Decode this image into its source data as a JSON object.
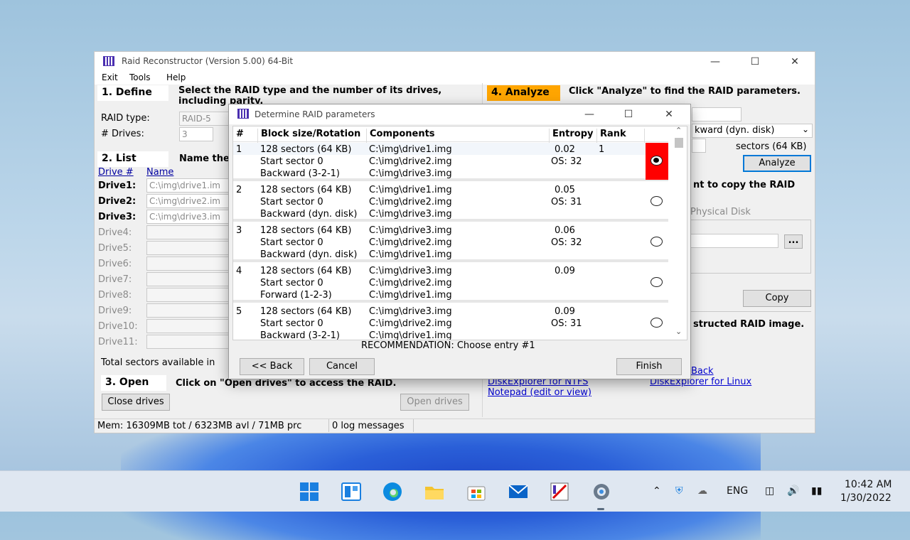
{
  "main": {
    "title": "Raid Reconstructor (Version 5.00) 64-Bit",
    "menu": [
      "Exit",
      "Tools",
      "Help"
    ],
    "define": {
      "header": "1. Define",
      "instruction": "Select the RAID type and the number of its drives, including parity.",
      "raid_type_label": "RAID type:",
      "raid_type_value": "RAID-5",
      "drives_label": "# Drives:",
      "drives_value": "3"
    },
    "list": {
      "header": "2. List",
      "instruction": "Name the",
      "col_drive": "Drive #",
      "col_name": "Name",
      "drives": [
        {
          "label": "Drive1:",
          "value": "C:\\img\\drive1.im"
        },
        {
          "label": "Drive2:",
          "value": "C:\\img\\drive2.im"
        },
        {
          "label": "Drive3:",
          "value": "C:\\img\\drive3.im"
        },
        {
          "label": "Drive4:",
          "value": ""
        },
        {
          "label": "Drive5:",
          "value": ""
        },
        {
          "label": "Drive6:",
          "value": ""
        },
        {
          "label": "Drive7:",
          "value": ""
        },
        {
          "label": "Drive8:",
          "value": ""
        },
        {
          "label": "Drive9:",
          "value": ""
        },
        {
          "label": "Drive10:",
          "value": ""
        },
        {
          "label": "Drive11:",
          "value": ""
        }
      ],
      "total_sectors": "Total sectors available in"
    },
    "open": {
      "header": "3. Open",
      "instruction": "Click on \"Open drives\" to access the RAID.",
      "close_button": "Close drives",
      "open_button": "Open drives"
    },
    "analyze": {
      "header": "4. Analyze",
      "instruction": "Click \"Analyze\" to find the RAID parameters.",
      "rotation_value": "kward (dyn. disk)",
      "block_value": "sectors (64 KB)",
      "analyze_button": "Analyze",
      "copy_text": "nt to copy the RAID",
      "physical_disk": "Physical Disk",
      "browse_button": "...",
      "copy_button": "Copy",
      "constructed_text": "structed RAID image.",
      "links": [
        "Back",
        "DiskExplorer for NTFS",
        "DiskExplorer for Linux",
        "Notepad (edit or view)"
      ]
    },
    "status": {
      "mem": "Mem: 16309MB tot / 6323MB avl / 71MB prc",
      "log": "0 log messages"
    }
  },
  "dialog": {
    "title": "Determine RAID parameters",
    "columns": [
      "#",
      "Block size/Rotation",
      "Components",
      "Entropy",
      "Rank"
    ],
    "entries": [
      {
        "num": "1",
        "block": "128 sectors (64 KB)",
        "start": "Start sector 0",
        "rotation": "Backward (3-2-1)",
        "components": [
          "C:\\img\\drive1.img",
          "C:\\img\\drive2.img",
          "C:\\img\\drive3.img"
        ],
        "entropy": "0.02",
        "os": "OS: 32",
        "rank": "1",
        "selected": true
      },
      {
        "num": "2",
        "block": "128 sectors (64 KB)",
        "start": "Start sector 0",
        "rotation": "Backward (dyn. disk)",
        "components": [
          "C:\\img\\drive1.img",
          "C:\\img\\drive2.img",
          "C:\\img\\drive3.img"
        ],
        "entropy": "0.05",
        "os": "OS: 31",
        "rank": "",
        "selected": false
      },
      {
        "num": "3",
        "block": "128 sectors (64 KB)",
        "start": "Start sector 0",
        "rotation": "Backward (dyn. disk)",
        "components": [
          "C:\\img\\drive3.img",
          "C:\\img\\drive2.img",
          "C:\\img\\drive1.img"
        ],
        "entropy": "0.06",
        "os": "OS: 32",
        "rank": "",
        "selected": false
      },
      {
        "num": "4",
        "block": "128 sectors (64 KB)",
        "start": "Start sector 0",
        "rotation": "Forward (1-2-3)",
        "components": [
          "C:\\img\\drive3.img",
          "C:\\img\\drive2.img",
          "C:\\img\\drive1.img"
        ],
        "entropy": "0.09",
        "os": "",
        "rank": "",
        "selected": false
      },
      {
        "num": "5",
        "block": "128 sectors (64 KB)",
        "start": "Start sector 0",
        "rotation": "Backward (3-2-1)",
        "components": [
          "C:\\img\\drive3.img",
          "C:\\img\\drive2.img",
          "C:\\img\\drive1.img"
        ],
        "entropy": "0.09",
        "os": "OS: 31",
        "rank": "",
        "selected": false
      }
    ],
    "recommendation": "RECOMMENDATION: Choose entry #1",
    "back_button": "<< Back",
    "cancel_button": "Cancel",
    "finish_button": "Finish"
  },
  "taskbar": {
    "apps": [
      "start-icon",
      "widgets-icon",
      "edge-icon",
      "file-explorer-icon",
      "store-icon",
      "mail-icon",
      "raid-app-icon",
      "settings-icon"
    ],
    "language": "ENG",
    "time": "10:42 AM",
    "date": "1/30/2022"
  },
  "colors": {
    "selected_row": "#ff0000",
    "focus_border": "#0078d7",
    "analyze_header": "#ffa500",
    "link": "#0000d0"
  }
}
